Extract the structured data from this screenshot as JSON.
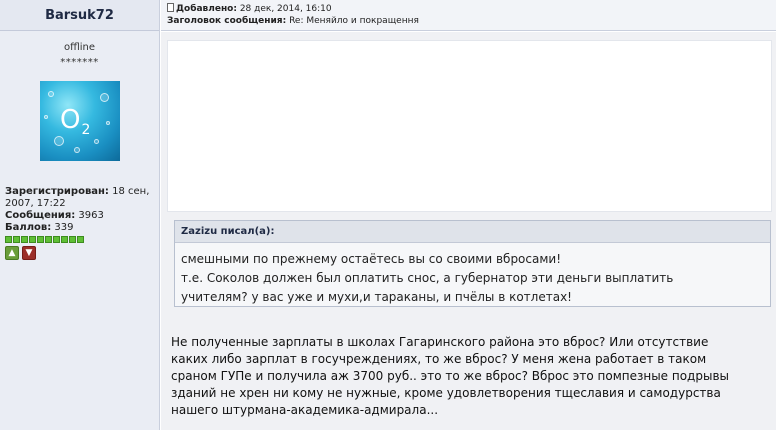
{
  "author": {
    "name": "Barsuk72",
    "status": "offline",
    "stars": "*******",
    "avatar_text": "O",
    "avatar_sub": "2",
    "registered_label": "Зарегистрирован:",
    "registered_value": "18 сен, 2007, 17:22",
    "messages_label": "Сообщения:",
    "messages_value": "3963",
    "points_label": "Баллов:",
    "points_value": "339",
    "reputation_level": 10,
    "reputation_max": 10
  },
  "post": {
    "added_label": "Добавлено:",
    "added_value": "28 дек, 2014, 16:10",
    "subject_label": "Заголовок сообщения:",
    "subject_value": "Re: Меняйло и покращення"
  },
  "quote": {
    "header": "Zazizu писал(а):",
    "lines": [
      "смешными по прежнему остаётесь вы со своими вбросами!",
      "т.е. Соколов должен был оплатить снос, а губернатор эти деньги выплатить",
      "учителям? у вас уже и мухи,и тараканы, и пчёлы в котлетах!"
    ]
  },
  "message": {
    "lines": [
      "Не полученные зарплаты в школах Гагаринского района это вброс? Или отсутствие",
      "каких либо зарплат в госучреждениях, то же вброс? У меня жена работает в таком",
      "сраном ГУПе и получила аж 3700 руб.. это то же вброс? Вброс это помпезные подрывы",
      "зданий не хрен ни кому не нужные, кроме удовлетворения тщеславия и самодурства",
      "нашего штурмана-академика-адмирала..."
    ]
  },
  "colors": {
    "sidebar_bg": "#eaedf4",
    "rep_green": "#5fbf35",
    "quote_header_bg": "#dfe3ea"
  }
}
